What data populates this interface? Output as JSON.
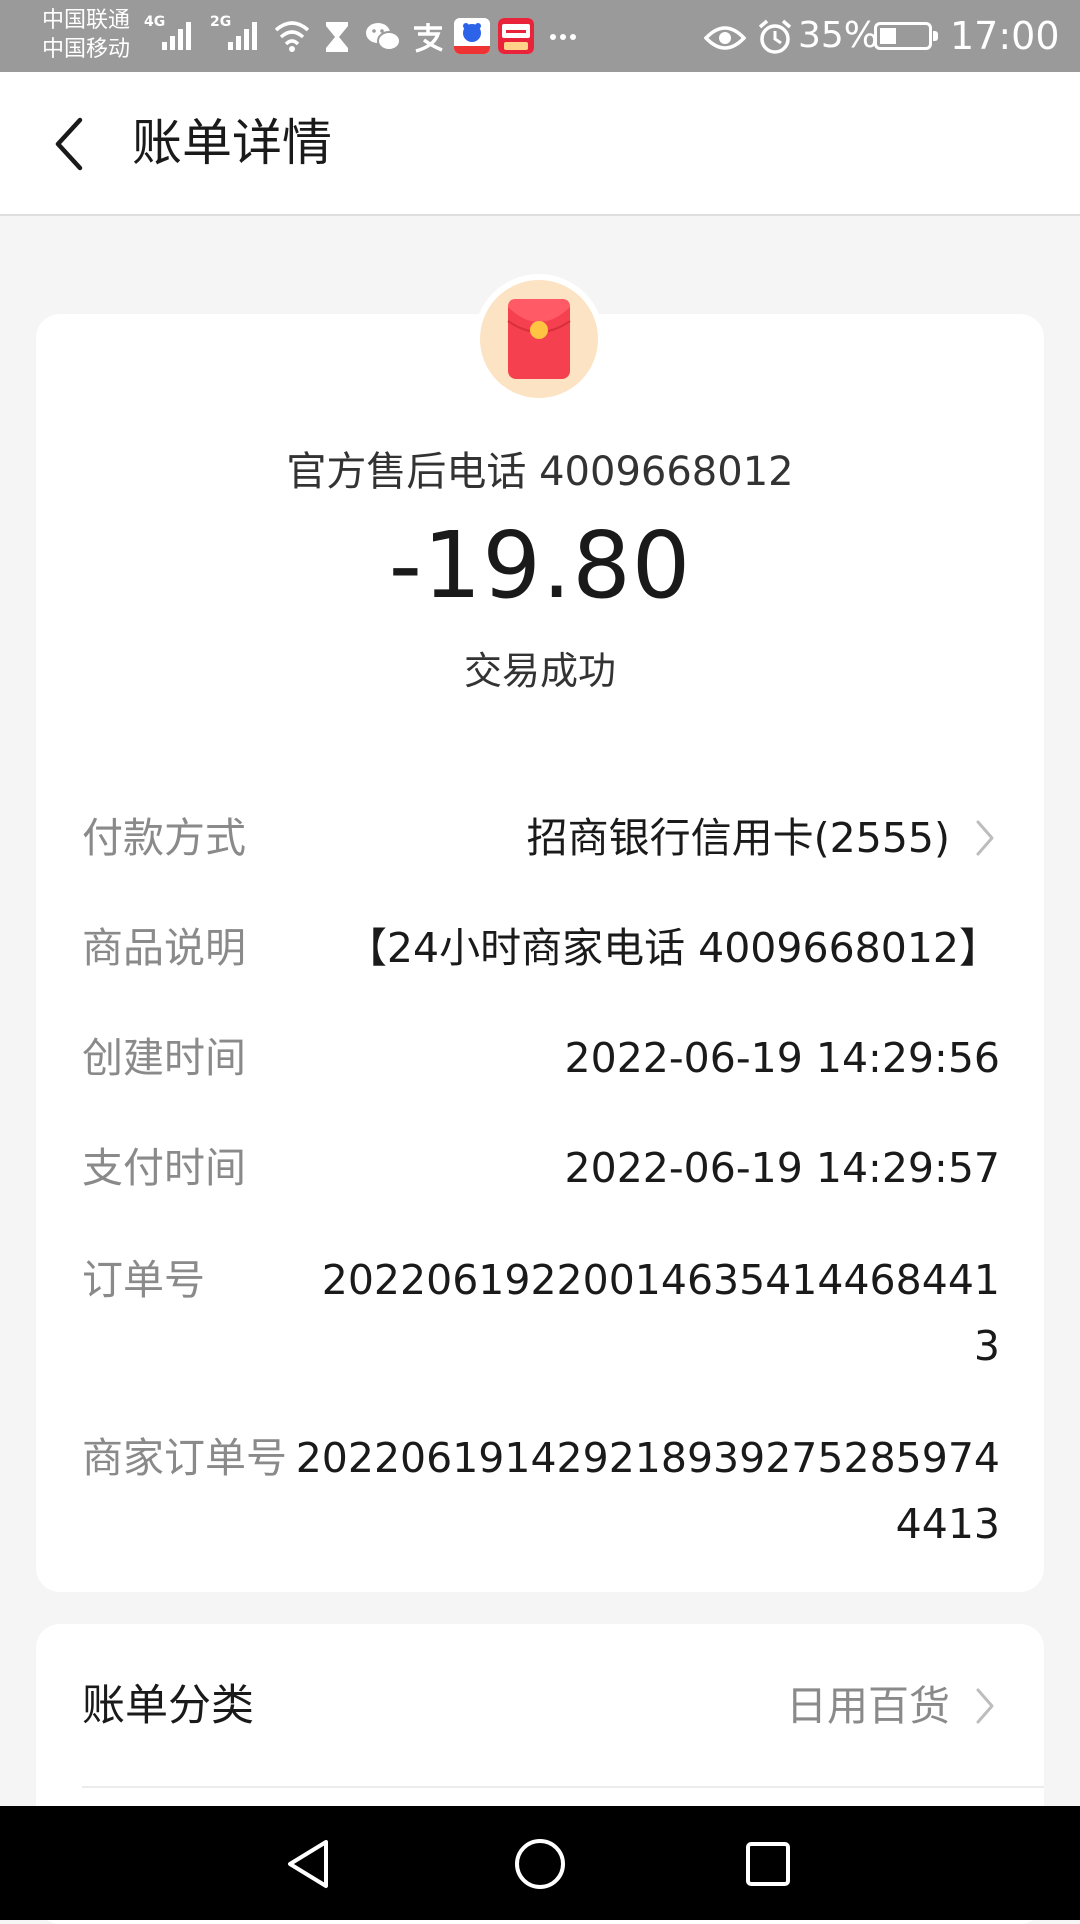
{
  "status_bar": {
    "carrier_1": "中国联通",
    "carrier_2": "中国移动",
    "net_1": "4G",
    "net_2": "2G",
    "battery_percent": "35%",
    "battery_level": 0.35,
    "time": "17:00",
    "icons": [
      "signal-icon",
      "signal-icon",
      "wifi-icon",
      "hourglass-icon",
      "wechat-icon",
      "alipay-icon",
      "baidu-app-icon",
      "taobao-app-icon",
      "more-icon",
      "eye-icon",
      "alarm-icon",
      "battery-icon"
    ]
  },
  "header": {
    "back_icon": "chevron-left-icon",
    "title": "账单详情"
  },
  "bill": {
    "merchant_icon": "red-envelope-icon",
    "merchant": "官方售后电话 4009668012",
    "amount": "-19.80",
    "status": "交易成功"
  },
  "details": {
    "payment_method": {
      "label": "付款方式",
      "value": "招商银行信用卡(2555)"
    },
    "product_desc": {
      "label": "商品说明",
      "value": "【24小时商家电话 4009668012】"
    },
    "created_time": {
      "label": "创建时间",
      "value": "2022-06-19 14:29:56"
    },
    "paid_time": {
      "label": "支付时间",
      "value": "2022-06-19 14:29:57"
    },
    "order_no": {
      "label": "订单号",
      "value": "20220619220014635414468441\n3"
    },
    "merchant_order_no": {
      "label": "商家订单号",
      "value": "202206191429218939275285974\n4413"
    }
  },
  "category": {
    "label": "账单分类",
    "value": "日用百货"
  },
  "colors": {
    "accent_red": "#f5414f",
    "icon_bg": "#fbe3c4",
    "status_bar": "#9a9a9a"
  }
}
